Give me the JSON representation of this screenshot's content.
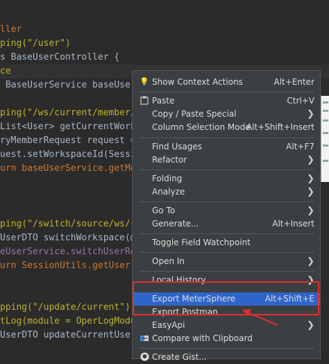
{
  "code": [
    "ller",
    "ping(\"/user\")",
    "s BaseUserController {",
    "ce",
    " BaseUserService baseUserS",
    "ping(\"/ws/current/member/l",
    "List<User> getCurrentWorks",
    "ryMemberRequest request =",
    "uest.setWorkspaceId(Sessio",
    "urn baseUserService.getMem",
    "ping(\"/switch/source/ws/{s",
    "UserDTO switchWorkspace(@P",
    "eUserService.switchUserRes",
    "urn SessionUtils.getUser()",
    "pping(\"/update/current\")",
    "tLog(module = OperLogModul",
    "UserDTO updateCurrentUser("
  ],
  "menu": {
    "items": [
      {
        "label": "Show Context Actions",
        "shortcut": "Alt+Enter",
        "icon": "bulb-icon"
      },
      {
        "label": "Paste",
        "shortcut": "Ctrl+V",
        "icon": "clipboard-icon"
      },
      {
        "label": "Copy / Paste Special",
        "submenu": true
      },
      {
        "label": "Column Selection Mode",
        "shortcut": "Alt+Shift+Insert"
      },
      {
        "label": "Find Usages",
        "shortcut": "Alt+F7"
      },
      {
        "label": "Refactor",
        "submenu": true
      },
      {
        "label": "Folding",
        "submenu": true
      },
      {
        "label": "Analyze",
        "submenu": true
      },
      {
        "label": "Go To",
        "submenu": true
      },
      {
        "label": "Generate...",
        "shortcut": "Alt+Insert"
      },
      {
        "label": "Toggle Field Watchpoint"
      },
      {
        "label": "Open In",
        "submenu": true
      },
      {
        "label": "Local History",
        "submenu": true
      },
      {
        "label": "Export MeterSphere",
        "shortcut": "Alt+Shift+E"
      },
      {
        "label": "Export Postman"
      },
      {
        "label": "EasyApi",
        "submenu": true
      },
      {
        "label": "Compare with Clipboard",
        "icon": "compare-icon"
      },
      {
        "label": "Create Gist...",
        "icon": "github-icon"
      }
    ]
  },
  "colors": {
    "editor_bg": "#2b2b2b",
    "menu_bg": "#3c3f41",
    "selection": "#2f65ca",
    "highlight_box": "#e03030"
  }
}
